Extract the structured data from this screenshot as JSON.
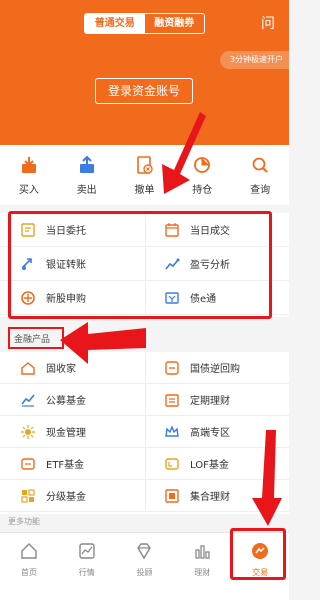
{
  "header": {
    "tabs": [
      "普通交易",
      "融资融券"
    ],
    "icon_label": "问",
    "quick_open": "3分钟极速开户",
    "login": "登录资金账号"
  },
  "quick_actions": [
    {
      "label": "买入",
      "icon": "buy-icon"
    },
    {
      "label": "卖出",
      "icon": "sell-icon"
    },
    {
      "label": "撤单",
      "icon": "cancel-order-icon"
    },
    {
      "label": "持仓",
      "icon": "position-icon"
    },
    {
      "label": "查询",
      "icon": "search-icon"
    }
  ],
  "menu_group_1": [
    [
      {
        "label": "当日委托",
        "icon": "today-order-icon"
      },
      {
        "label": "当日成交",
        "icon": "today-deal-icon"
      }
    ],
    [
      {
        "label": "银证转账",
        "icon": "transfer-icon"
      },
      {
        "label": "盈亏分析",
        "icon": "profit-analysis-icon"
      }
    ],
    [
      {
        "label": "新股申购",
        "icon": "ipo-icon"
      },
      {
        "label": "债e通",
        "icon": "bond-icon"
      }
    ]
  ],
  "finance_title": "金融产品",
  "menu_group_2": [
    [
      {
        "label": "固收家",
        "icon": "fixed-income-icon"
      },
      {
        "label": "国债逆回购",
        "icon": "repo-icon"
      }
    ],
    [
      {
        "label": "公募基金",
        "icon": "fund-icon"
      },
      {
        "label": "定期理财",
        "icon": "fixed-term-icon"
      }
    ],
    [
      {
        "label": "现金管理",
        "icon": "cash-icon"
      },
      {
        "label": "高端专区",
        "icon": "premium-icon"
      }
    ],
    [
      {
        "label": "ETF基金",
        "icon": "etf-icon"
      },
      {
        "label": "LOF基金",
        "icon": "lof-icon"
      }
    ],
    [
      {
        "label": "分级基金",
        "icon": "graded-fund-icon"
      },
      {
        "label": "集合理财",
        "icon": "collective-icon"
      }
    ]
  ],
  "peek_title": "更多功能",
  "tabbar": [
    {
      "label": "首页",
      "icon": "home-icon"
    },
    {
      "label": "行情",
      "icon": "market-icon"
    },
    {
      "label": "投顾",
      "icon": "advisor-icon"
    },
    {
      "label": "理财",
      "icon": "finance-icon"
    },
    {
      "label": "交易",
      "icon": "trade-icon"
    }
  ],
  "colors": {
    "brand": "#f26b1d",
    "annotation": "#e8161a"
  }
}
